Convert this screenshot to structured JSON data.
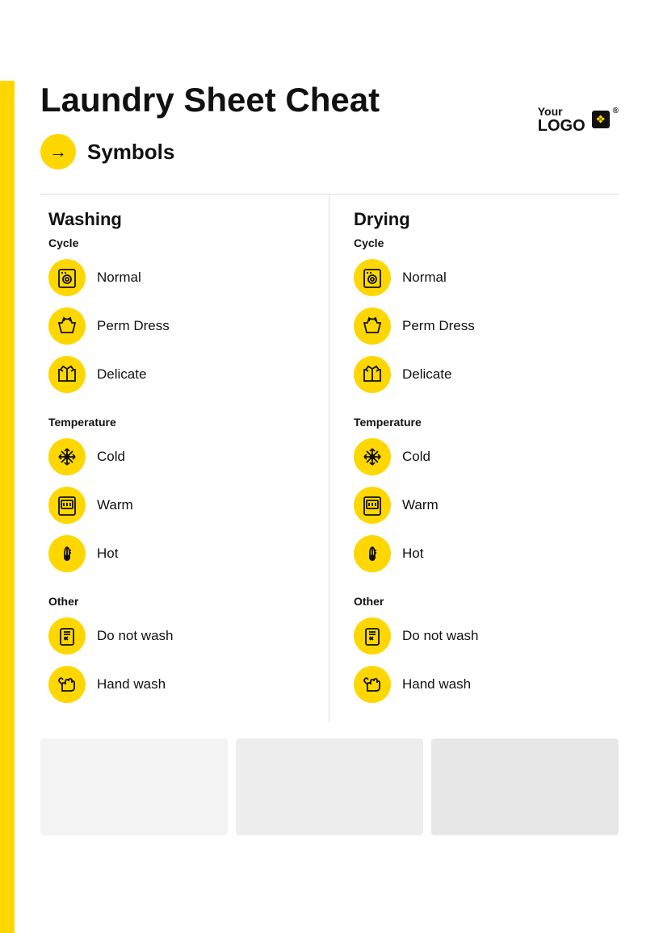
{
  "logo": {
    "line1": "Your",
    "line2": "LOGO",
    "registered": "®"
  },
  "title": "Laundry Sheet Cheat",
  "symbols_label": "Symbols",
  "arrow": "→",
  "columns": [
    {
      "id": "washing",
      "title": "Washing",
      "cycle_label": "Cycle",
      "temperature_label": "Temperature",
      "other_label": "Other",
      "cycle_items": [
        {
          "icon": "washer",
          "label": "Normal"
        },
        {
          "icon": "dress",
          "label": "Perm Dress"
        },
        {
          "icon": "jacket",
          "label": "Delicate"
        }
      ],
      "temperature_items": [
        {
          "icon": "snowflake",
          "label": "Cold"
        },
        {
          "icon": "washer",
          "label": "Warm"
        },
        {
          "icon": "thermometer",
          "label": "Hot"
        }
      ],
      "other_items": [
        {
          "icon": "no-wash",
          "label": "Do not wash"
        },
        {
          "icon": "hand",
          "label": "Hand wash"
        }
      ]
    },
    {
      "id": "drying",
      "title": "Drying",
      "cycle_label": "Cycle",
      "temperature_label": "Temperature",
      "other_label": "Other",
      "cycle_items": [
        {
          "icon": "washer",
          "label": "Normal"
        },
        {
          "icon": "dress",
          "label": "Perm Dress"
        },
        {
          "icon": "jacket",
          "label": "Delicate"
        }
      ],
      "temperature_items": [
        {
          "icon": "snowflake",
          "label": "Cold"
        },
        {
          "icon": "washer",
          "label": "Warm"
        },
        {
          "icon": "thermometer",
          "label": "Hot"
        }
      ],
      "other_items": [
        {
          "icon": "no-wash",
          "label": "Do not wash"
        },
        {
          "icon": "hand",
          "label": "Hand wash"
        }
      ]
    }
  ],
  "colors": {
    "accent": "#FFD700",
    "text": "#111111",
    "divider": "#dddddd"
  }
}
